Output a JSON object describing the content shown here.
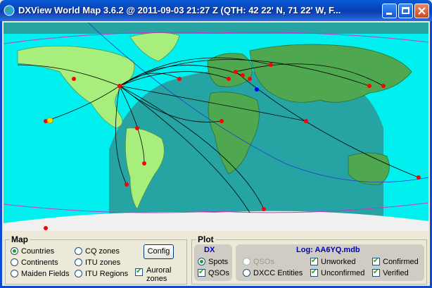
{
  "window": {
    "title": "DXView World Map 3.6.2 @ 2011-09-03  21:27 Z  (QTH:  42  22' N,  71  22' W, F...",
    "icon": "globe-icon"
  },
  "map": {
    "colors": {
      "ocean": "#00f0f0",
      "night": "#26a3a3",
      "land_lit": "#a8ee7c",
      "land_dark": "#4fa84f",
      "antarctica": "#f0f0f0",
      "spot": "#ff0000",
      "qth": "#0000ff",
      "sun": "#ffdd00"
    }
  },
  "map_group": {
    "title": "Map",
    "options": [
      {
        "label": "Countries",
        "selected": true
      },
      {
        "label": "CQ zones",
        "selected": false
      },
      {
        "label": "Continents",
        "selected": false
      },
      {
        "label": "ITU zones",
        "selected": false
      },
      {
        "label": "Maiden Fields",
        "selected": false
      },
      {
        "label": "ITU Regions",
        "selected": false
      }
    ],
    "config_label": "Config",
    "auroral_label": "Auroral\nzones",
    "auroral_checked": true
  },
  "plot_group": {
    "title": "Plot",
    "dx": {
      "title": "DX",
      "spots_label": "Spots",
      "spots_selected": true,
      "qsos_label": "QSOs",
      "qsos_checked": true
    },
    "log": {
      "title": "Log: AA6YQ.mdb",
      "qsos_label": "QSOs",
      "dxcc_label": "DXCC Entities",
      "unworked_label": "Unworked",
      "unworked_checked": true,
      "unconfirmed_label": "Unconfirmed",
      "unconfirmed_checked": true,
      "confirmed_label": "Confirmed",
      "confirmed_checked": true,
      "verified_label": "Verified",
      "verified_checked": true
    }
  }
}
